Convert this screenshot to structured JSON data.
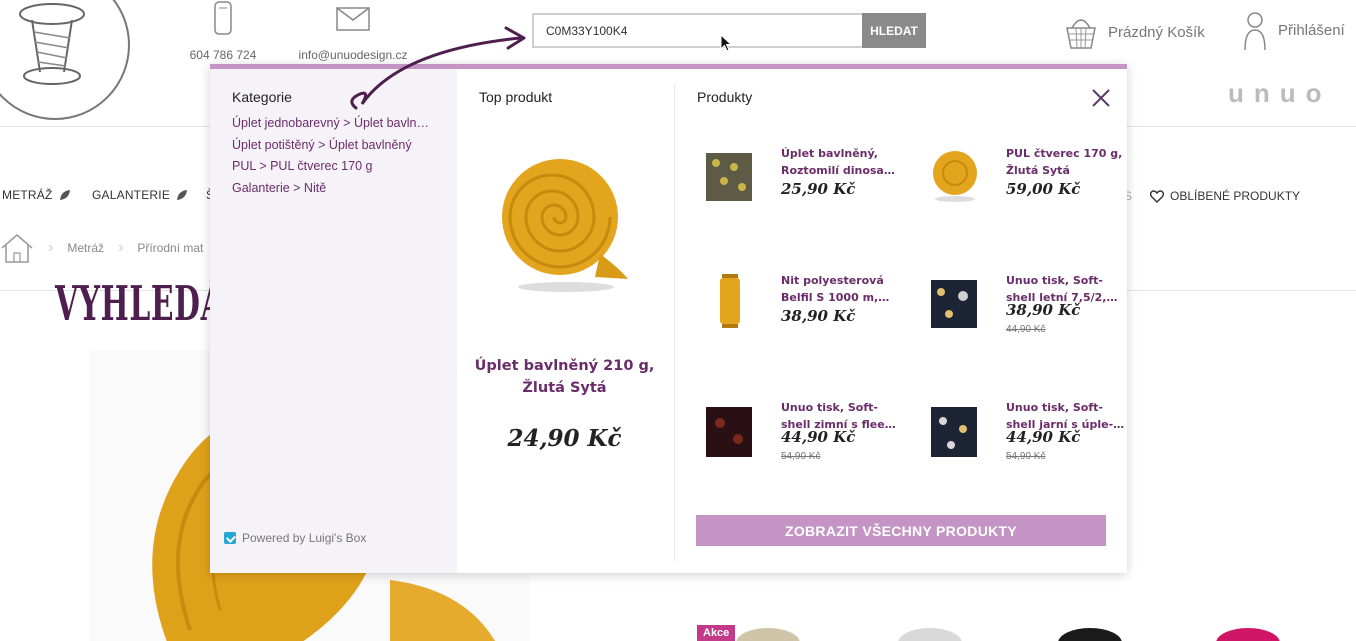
{
  "header": {
    "phone": "604 786 724",
    "email": "info@unuodesign.cz",
    "search_value": "C0M33Y100K4",
    "search_button": "HLEDAT",
    "cart_label": "Prázdný Košík",
    "login_label": "Přihlášení",
    "brand": "unuo"
  },
  "nav": {
    "items": [
      "METRÁŽ",
      "GALANTERIE",
      "Š"
    ],
    "favorites": "OBLÍBENÉ PRODUKTY",
    "favorites_prefix": "S"
  },
  "breadcrumb": [
    "Metráž",
    "Přírodní mat"
  ],
  "headline": "VYHLEDÁNÍ DLE STEJNÉHO CMYKU",
  "dropdown": {
    "categories_title": "Kategorie",
    "categories": [
      "Úplet jednobarevný > Úplet bavln…",
      "Úplet potištěný > Úplet bavlněný",
      "PUL > PUL čtverec 170 g",
      "Galanterie > Nitě"
    ],
    "powered_by": "Powered by Luigi's Box",
    "top_title": "Top produkt",
    "top_product": {
      "name_line1": "Úplet bavlněný 210 g,",
      "name_line2": "Žlutá Sytá",
      "price": "24,90 Kč"
    },
    "products_title": "Produkty",
    "products": [
      {
        "name1": "Úplet bavlněný,",
        "name2": "Roztomilí dinosa…",
        "price": "25,90 Kč",
        "old": ""
      },
      {
        "name1": "PUL čtverec 170 g,",
        "name2": "Žlutá Sytá",
        "price": "59,00 Kč",
        "old": ""
      },
      {
        "name1": "Nit polyesterová",
        "name2": "Belfil S 1000 m,…",
        "price": "38,90 Kč",
        "old": ""
      },
      {
        "name1": "Unuo tisk, Soft-",
        "name2": "shell letní 7,5/2,…",
        "price": "38,90 Kč",
        "old": "44,90 Kč"
      },
      {
        "name1": "Unuo tisk, Soft-",
        "name2": "shell zimní s flee…",
        "price": "44,90 Kč",
        "old": "54,90 Kč"
      },
      {
        "name1": "Unuo tisk, Soft-",
        "name2": "shell jarní s úple-…",
        "price": "44,90 Kč",
        "old": "54,90 Kč"
      }
    ],
    "show_all": "ZOBRAZIT VŠECHNY PRODUKTY"
  },
  "badge_akce": "Akce",
  "colors": {
    "accent": "#c394c4",
    "product_text": "#6a2c6a",
    "headline": "#4e1f4e",
    "mustard": "#e0a11a"
  }
}
